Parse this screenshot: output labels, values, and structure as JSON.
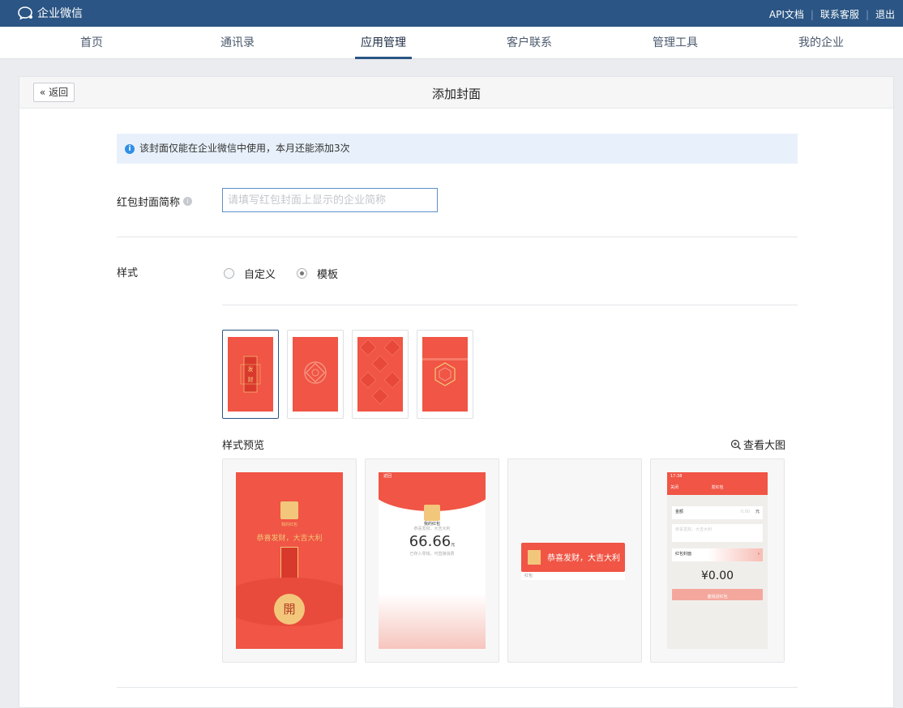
{
  "topbar": {
    "brand": "企业微信",
    "links": [
      "API文档",
      "联系客服",
      "退出"
    ],
    "bg_color": "#2a5584"
  },
  "nav": {
    "items": [
      "首页",
      "通讯录",
      "应用管理",
      "客户联系",
      "管理工具",
      "我的企业"
    ],
    "active": "应用管理"
  },
  "page": {
    "back_label": "返回",
    "title": "添加封面",
    "notice": "该封面仅能在企业微信中使用，本月还能添加3次",
    "name_label": "红包封面简称",
    "name_placeholder": "请填写红包封面上显示的企业简称",
    "style_label": "样式",
    "style_options": [
      "自定义",
      "模板"
    ],
    "style_selected": "模板",
    "preview_label": "样式预览",
    "zoom_label": "查看大图"
  },
  "preview": {
    "p1": {
      "title": "我的红包",
      "greeting": "恭喜发财，大吉大利",
      "open": "開"
    },
    "p2": {
      "back": "返回",
      "title": "我的红包",
      "sub": "恭喜发财，大吉大利",
      "amount": "66.66",
      "unit": "元",
      "note": "已存入零钱，可直接消费"
    },
    "p3": {
      "greeting": "恭喜发财，大吉大利",
      "caption": "红包"
    },
    "p4": {
      "time": "17:38",
      "close": "关闭",
      "title": "发红包",
      "amount_label": "金额",
      "amount_unit": "元",
      "amount_hint": "0.00",
      "greeting_placeholder": "恭喜发财，大吉大利",
      "cover_label": "红包封面",
      "total": "¥0.00",
      "button": "塞钱进红包"
    }
  },
  "colors": {
    "accent": "#2a5584",
    "red": "#f05545",
    "gold": "#f3c77b"
  }
}
